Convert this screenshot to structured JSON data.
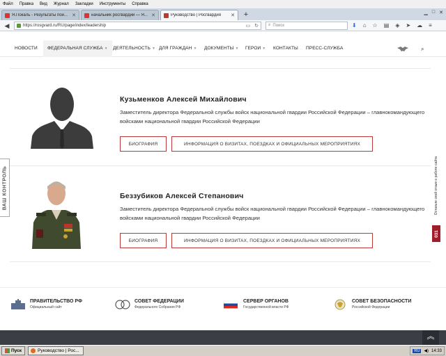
{
  "browser": {
    "menu": [
      "Файл",
      "Правка",
      "Вид",
      "Журнал",
      "Закладки",
      "Инструменты",
      "Справка"
    ],
    "tabs": [
      {
        "title": "Я.Покаль - Результаты пои...",
        "active": false,
        "favicon_color": "#e0332f"
      },
      {
        "title": "начальник росгвардии — Я...",
        "active": false,
        "favicon_color": "#e0332f"
      },
      {
        "title": "Руководство | Росгвардия",
        "active": true,
        "favicon_color": "#c0392b"
      }
    ],
    "url": "https://rosgvard.ru/RU/page/index/leadership",
    "search_placeholder": "Поиск"
  },
  "site": {
    "nav": [
      "НОВОСТИ",
      "ФЕДЕРАЛЬНАЯ СЛУЖБА",
      "ДЕЯТЕЛЬНОСТЬ",
      "ДЛЯ ГРАЖДАН",
      "ДОКУМЕНТЫ",
      "ГЕРОИ",
      "КОНТАКТЫ",
      "ПРЕСС-СЛУЖБА"
    ],
    "nav_selected": 1,
    "people": [
      {
        "name": "Кузьменков Алексей Михайлович",
        "position": "Заместитель директора Федеральной службы войск национальной гвардии Российской Федерации – главнокомандующего войсками национальной гвардии Российской Федерации",
        "bio_label": "БИОГРАФИЯ",
        "visits_label": "ИНФОРМАЦИЯ О ВИЗИТАХ, ПОЕЗДКАХ И ОФИЦИАЛЬНЫХ МЕРОПРИЯТИЯХ"
      },
      {
        "name": "Беззубиков Алексей Степанович",
        "position": "Заместитель директора Федеральной службы войск национальной гвардии Российской Федерации – главнокомандующего войсками национальной гвардии Российской Федерации",
        "bio_label": "БИОГРАФИЯ",
        "visits_label": "ИНФОРМАЦИЯ О ВИЗИТАХ, ПОЕЗДКАХ И ОФИЦИАЛЬНЫХ МЕРОПРИЯТИЯХ"
      }
    ],
    "side_left_label": "ВАШ КОНТРОЛЬ",
    "side_right_label": "Оставьте свой отзыв о работе сайта",
    "side_right_number": "031",
    "footer_links": [
      {
        "title": "ПРАВИТЕЛЬСТВО РФ",
        "subtitle": "Официальный сайт"
      },
      {
        "title": "СОВЕТ ФЕДЕРАЦИИ",
        "subtitle": "Федерального Собрания РФ"
      },
      {
        "title": "СЕРВЕР ОРГАНОВ",
        "subtitle": "Государственной власти РФ"
      },
      {
        "title": "СОВЕТ БЕЗОПАСНОСТИ",
        "subtitle": "Российской Федерации"
      }
    ],
    "accent_color": "#b63a3a"
  },
  "taskbar": {
    "start_label": "Пуск",
    "window_title": "Руководство | Рос...",
    "lang": "RU",
    "time": "14:33"
  }
}
